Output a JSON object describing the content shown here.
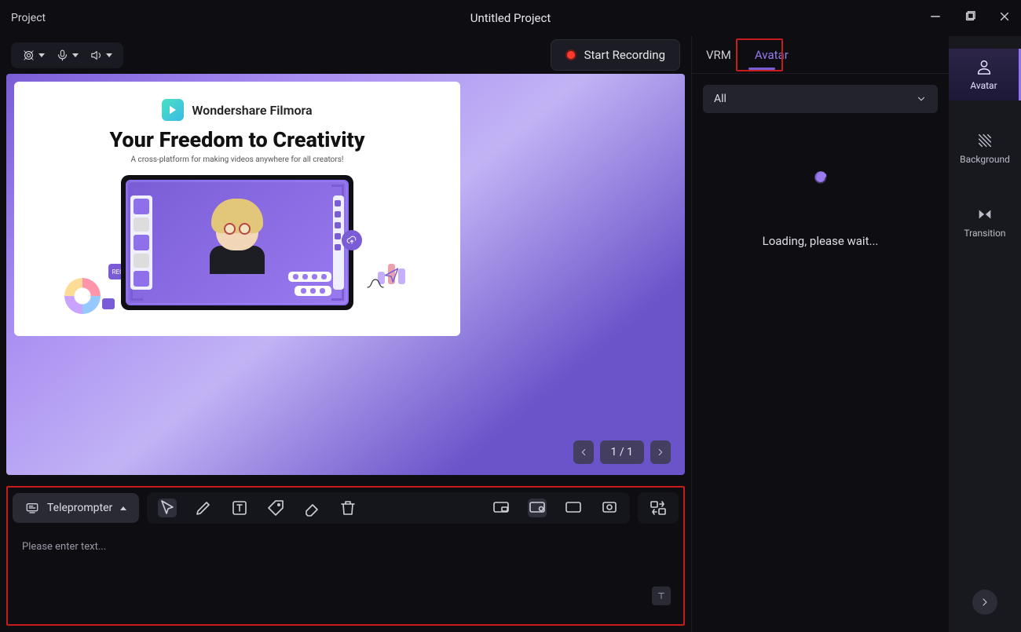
{
  "titlebar": {
    "menu": "Project",
    "title": "Untitled Project"
  },
  "toolbar": {
    "record_label": "Start Recording"
  },
  "slide": {
    "logo_text": "Wondershare Filmora",
    "headline": "Your Freedom to Creativity",
    "subtitle": "A cross-platform for making videos anywhere for all creators!",
    "rec_badge": "REC"
  },
  "pager": {
    "display": "1 / 1"
  },
  "bottom": {
    "teleprompter_label": "Teleprompter",
    "placeholder": "Please enter text..."
  },
  "panel": {
    "tabs": {
      "vrm": "VRM",
      "avatar": "Avatar"
    },
    "filter_value": "All",
    "loading_text": "Loading, please wait..."
  },
  "rail": {
    "avatar": "Avatar",
    "background": "Background",
    "transition": "Transition"
  }
}
